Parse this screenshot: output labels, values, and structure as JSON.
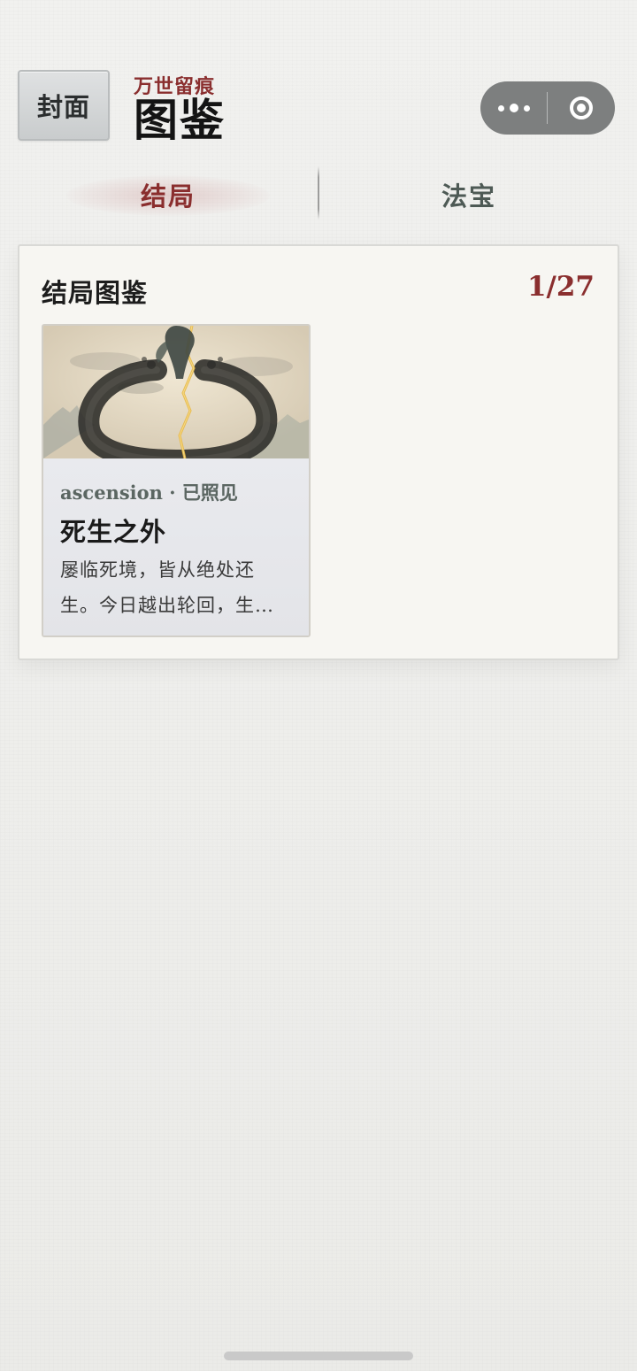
{
  "header": {
    "cover_label": "封面",
    "subtitle": "万世留痕",
    "title": "图鉴"
  },
  "capsule": {
    "more_icon": "more-dots-icon",
    "close_icon": "target-close-icon"
  },
  "tabs": [
    {
      "label": "结局",
      "active": true
    },
    {
      "label": "法宝",
      "active": false
    }
  ],
  "panel": {
    "title": "结局图鉴",
    "count": "1/27"
  },
  "cards": [
    {
      "meta": "ascension · 已照见",
      "title": "死生之外",
      "description": "屡临死境，皆从绝处还生。今日越出轮回，生死之外自有天地。",
      "image_icon": "ink-ring-ascension-art"
    }
  ],
  "colors": {
    "accent": "#8a2e2e",
    "background": "#ececea",
    "panel": "#f7f6f2"
  }
}
